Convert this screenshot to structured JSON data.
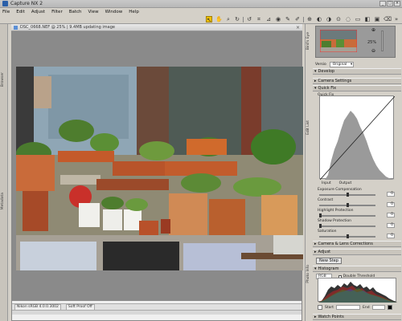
{
  "window": {
    "title": "Capture NX 2",
    "controls": [
      "_",
      "□",
      "×"
    ]
  },
  "menu": [
    "File",
    "Edit",
    "Adjust",
    "Filter",
    "Batch",
    "View",
    "Window",
    "Help"
  ],
  "document": {
    "tab_title": "DSC_0668.NEF @ 25% | 9.4MB updating image",
    "status_profile": "Nikon sRGB 4.0.0.3002",
    "status_softproof": "Soft Proof Off"
  },
  "birds_eye": {
    "zoom": "25",
    "zoom_unit": "%"
  },
  "edit_list": {
    "version_label": "Versio",
    "version_value": "Original",
    "develop_label": "Develop",
    "camera_settings_label": "Camera Settings",
    "quick_fix_label": "Quick Fix",
    "quick_fix_inner_label": "Quick Fix",
    "curve_input_label": "Input",
    "curve_output_label": "Output",
    "sliders": [
      {
        "label": "Exposure Compensation",
        "value": "0"
      },
      {
        "label": "Contrast",
        "value": "0"
      },
      {
        "label": "Highlight Protection",
        "value": "0"
      },
      {
        "label": "Shadow Protection",
        "value": "0"
      },
      {
        "label": "Saturation",
        "value": "0"
      }
    ],
    "camera_lens_label": "Camera & Lens Corrections",
    "adjust_label": "Adjust",
    "new_step_label": "New Step"
  },
  "histogram": {
    "title": "Histogram",
    "channel": "RGB",
    "double_threshold": "Double Threshold",
    "start_label": "Start",
    "end_label": "End",
    "start_value": "",
    "end_value": ""
  },
  "watch_points": {
    "label": "Watch Points"
  },
  "side_tabs": {
    "left_top": "Browser",
    "left_bottom": "Metadata",
    "right_mid": "Edit List",
    "right_low": "Photo Info"
  },
  "colors": {
    "highlight": "#f0c000",
    "panel_bg": "#d4d0c8",
    "canvas_bg": "#8a8a8a"
  }
}
